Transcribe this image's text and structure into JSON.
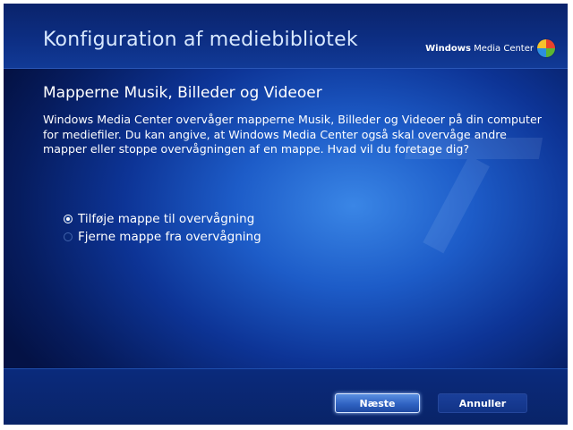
{
  "header": {
    "title": "Konfiguration af mediebibliotek",
    "brand_prefix": "Windows",
    "brand_suffix": "Media Center"
  },
  "page": {
    "subtitle": "Mapperne Musik, Billeder og Videoer",
    "description": "Windows Media Center overvåger mapperne Musik, Billeder og Videoer på din computer for mediefiler. Du kan angive, at Windows Media Center også skal overvåge andre mapper eller stoppe overvågningen af en mappe. Hvad vil du foretage dig?"
  },
  "options": [
    {
      "label": "Tilføje mappe til overvågning",
      "selected": true
    },
    {
      "label": "Fjerne mappe fra overvågning",
      "selected": false
    }
  ],
  "buttons": {
    "next_label": "Næste",
    "cancel_label": "Annuller"
  },
  "icons": {
    "brand_logo": "windows-flag-icon",
    "radio_selected": "radio-selected-icon",
    "radio_unselected": "radio-unselected-icon"
  }
}
